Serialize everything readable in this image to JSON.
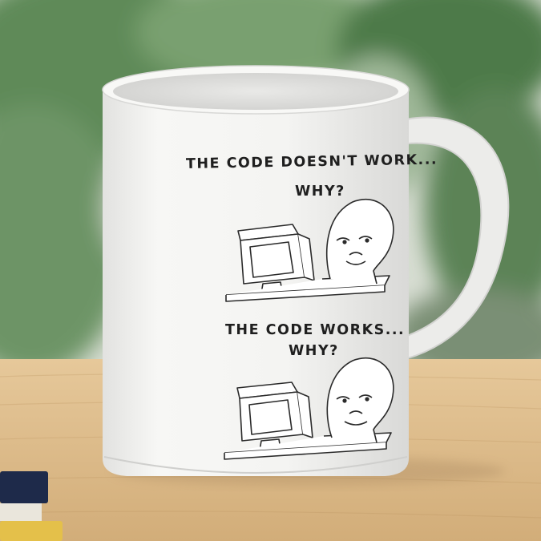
{
  "scene": {
    "description_colors": {
      "background_green": "#6f8f68",
      "table_wood": "#d9b98a",
      "mug_white": "#f4f4f2",
      "book_navy": "#1e2a4a"
    }
  },
  "mug": {
    "panel_top": {
      "caption_line1": "THE CODE DOESN'T WORK...",
      "caption_line2": "WHY?"
    },
    "panel_bottom": {
      "caption_line1": "THE CODE WORKS...",
      "caption_line2": "WHY?"
    }
  }
}
